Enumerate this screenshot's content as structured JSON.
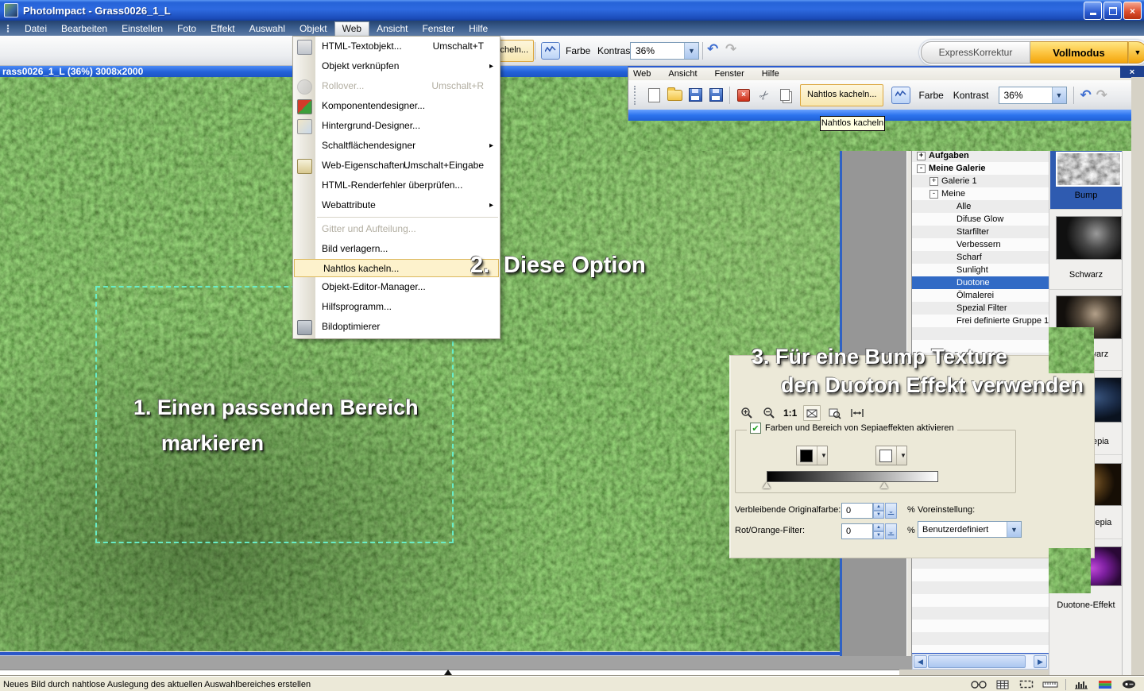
{
  "titlebar": {
    "title": "PhotoImpact - Grass0026_1_L"
  },
  "menubar": {
    "items": [
      "Datei",
      "Bearbeiten",
      "Einstellen",
      "Foto",
      "Effekt",
      "Auswahl",
      "Objekt",
      "Web",
      "Ansicht",
      "Fenster",
      "Hilfe"
    ]
  },
  "main_toolbar": {
    "tile_button": "Nahtlos kacheln...",
    "color_label": "Farbe",
    "contrast_label": "Kontrast",
    "zoom_value": "36%"
  },
  "mode_buttons": {
    "express": "ExpressKorrektur",
    "full": "Vollmodus"
  },
  "image_window": {
    "title": "rass0026_1_L (36%) 3008x2000"
  },
  "web_menu": {
    "items": [
      {
        "label": "HTML-Textobjekt...",
        "shortcut": "Umschalt+T"
      },
      {
        "label": "Objekt verknüpfen",
        "submenu": true
      },
      {
        "label": "Rollover...",
        "shortcut": "Umschalt+R",
        "disabled": true
      },
      {
        "label": "Komponentendesigner..."
      },
      {
        "label": "Hintergrund-Designer..."
      },
      {
        "label": "Schaltflächendesigner",
        "submenu": true
      },
      {
        "label": "Web-Eigenschaften...",
        "shortcut": "Umschalt+Eingabe"
      },
      {
        "label": "HTML-Renderfehler überprüfen..."
      },
      {
        "label": "Webattribute",
        "submenu": true
      },
      {
        "label": "Gitter und Aufteilung...",
        "disabled": true
      },
      {
        "label": "Bild verlagern..."
      },
      {
        "label": "Nahtlos kacheln...",
        "highlighted": true
      },
      {
        "label": "Objekt-Editor-Manager..."
      },
      {
        "label": "Hilfsprogramm..."
      },
      {
        "label": "Bildoptimierer"
      }
    ]
  },
  "overlay_window": {
    "menu_items": [
      "Web",
      "Ansicht",
      "Fenster",
      "Hilfe"
    ],
    "tile_button": "Nahtlos kacheln...",
    "color_label": "Farbe",
    "contrast_label": "Kontrast",
    "zoom_value": "36%",
    "tooltip": "Nahtlos kacheln"
  },
  "gallery": {
    "tree": [
      {
        "label": "Aufgaben",
        "expander": "+",
        "bold": true
      },
      {
        "label": "Meine Galerie",
        "expander": "-",
        "bold": true
      },
      {
        "label": "Galerie 1",
        "expander": "+"
      },
      {
        "label": "Meine",
        "expander": "-"
      },
      {
        "label": "Alle"
      },
      {
        "label": "Difuse Glow"
      },
      {
        "label": "Starfilter"
      },
      {
        "label": "Verbessern"
      },
      {
        "label": "Scharf"
      },
      {
        "label": "Sunlight"
      },
      {
        "label": "Duotone",
        "selected": true
      },
      {
        "label": "Ölmalerei"
      },
      {
        "label": "Spezial Filter"
      },
      {
        "label": "Frei definierte Gruppe 1"
      }
    ]
  },
  "thumbnails": {
    "items": [
      {
        "label": "Bump",
        "selected": true
      },
      {
        "label": "Schwarz"
      },
      {
        "label": "warz"
      },
      {
        "label": "epia"
      },
      {
        "label": "sepia"
      },
      {
        "label": "Duotone-Effekt"
      }
    ]
  },
  "duotone_panel": {
    "zoom_ratio": "1:1",
    "checkbox_label": "Farben und Bereich von Sepiaeffekten aktivieren",
    "remaining_label": "Verbleibende Originalfarbe:",
    "remaining_value": "0",
    "filter_label": "Rot/Orange-Filter:",
    "filter_value": "0",
    "percent": "%",
    "preset_label": "Voreinstellung:",
    "preset_value": "Benutzerdefiniert"
  },
  "annotations": {
    "step1_line1": "1. Einen passenden Bereich",
    "step1_line2": "markieren",
    "step2_num": "2.",
    "step2_text": "Diese Option",
    "step3_line1": "3. Für eine Bump Texture",
    "step3_line2": "den Duoton Effekt verwenden"
  },
  "statusbar": {
    "text": "Neues Bild durch nahtlose Auslegung des aktuellen Auswahlbereiches erstellen"
  },
  "colors": {
    "selection_blue": "#316ac5",
    "menu_highlight": "#fdf2cc",
    "accent_orange": "#dca73f",
    "overlay_blue": "#2d74ee"
  }
}
